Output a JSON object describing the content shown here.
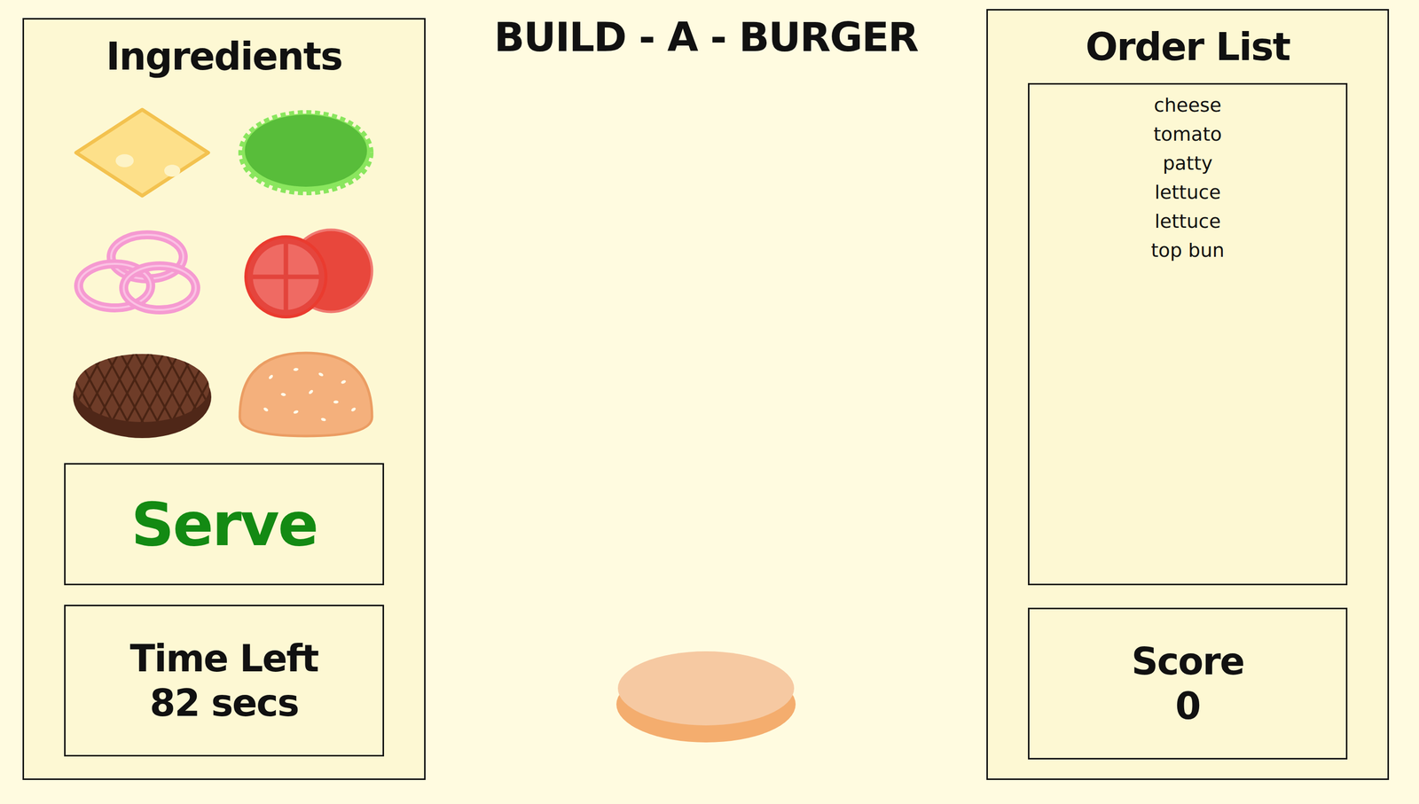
{
  "title": "BUILD - A - BURGER",
  "ingredients_panel": {
    "heading": "Ingredients",
    "items": [
      {
        "kind": "cheese"
      },
      {
        "kind": "lettuce"
      },
      {
        "kind": "onion"
      },
      {
        "kind": "tomato"
      },
      {
        "kind": "patty"
      },
      {
        "kind": "bun"
      }
    ],
    "serve_button": "Serve",
    "timer": {
      "label": "Time Left",
      "value": "82 secs"
    }
  },
  "stack": [
    {
      "kind": "bottom-bun"
    }
  ],
  "order_panel": {
    "heading": "Order List",
    "items": [
      "cheese",
      "tomato",
      "patty",
      "lettuce",
      "lettuce",
      "top bun"
    ],
    "score": {
      "label": "Score",
      "value": "0"
    }
  }
}
